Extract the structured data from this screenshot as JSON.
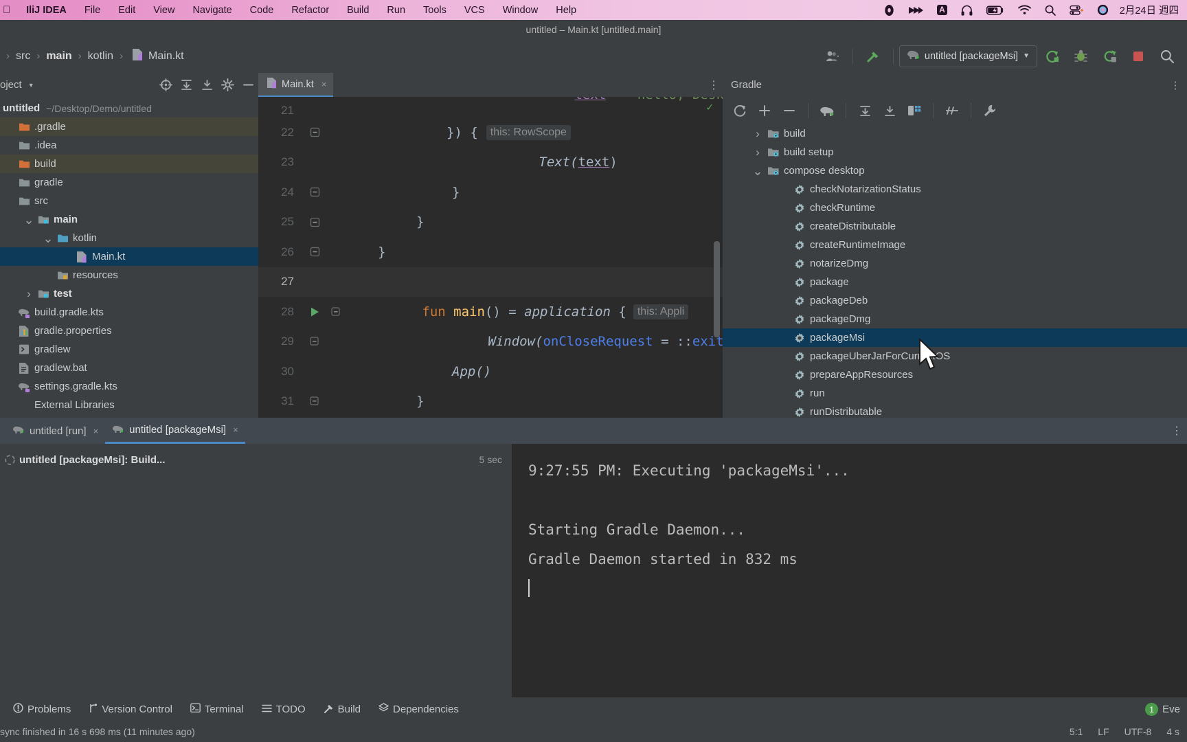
{
  "macbar": {
    "apple_glyph": "●",
    "menus": [
      {
        "label": "IliJ IDEA",
        "bold": true
      },
      {
        "label": "File",
        "bold": false
      },
      {
        "label": "Edit",
        "bold": false
      },
      {
        "label": "View",
        "bold": false
      },
      {
        "label": "Navigate",
        "bold": false
      },
      {
        "label": "Code",
        "bold": false
      },
      {
        "label": "Refactor",
        "bold": false
      },
      {
        "label": "Build",
        "bold": false
      },
      {
        "label": "Run",
        "bold": false
      },
      {
        "label": "Tools",
        "bold": false
      },
      {
        "label": "VCS",
        "bold": false
      },
      {
        "label": "Window",
        "bold": false
      },
      {
        "label": "Help",
        "bold": false
      }
    ],
    "status_icons": [
      "record-icon",
      "fastforward-icon",
      "input-source-A-icon",
      "headphones-icon",
      "battery-charging-icon",
      "wifi-icon",
      "search-icon",
      "control-center-icon",
      "siri-icon"
    ],
    "date": "2月24日 週四"
  },
  "titlebar": {
    "title": "untitled – Main.kt [untitled.main]"
  },
  "navbar": {
    "breadcrumbs": [
      "src",
      "main",
      "kotlin",
      "Main.kt"
    ],
    "separator": "›",
    "run_config": "untitled [packageMsi]",
    "buttons": [
      "account-icon",
      "hammer-build-icon",
      "rerun-icon",
      "debug-icon",
      "coverage-icon",
      "stop-icon",
      "search-everywhere-icon"
    ]
  },
  "project": {
    "title": "oject",
    "toolbar_icons": [
      "locate-icon",
      "expand-all-icon",
      "collapse-all-icon",
      "settings-gear-icon",
      "hide-icon"
    ],
    "root": {
      "name": "untitled",
      "path": "~/Desktop/Demo/untitled"
    },
    "items": [
      {
        "label": ".gradle",
        "icon": "folder-excluded-icon",
        "indent": 0,
        "arrow": "",
        "highlight": true,
        "selected": false,
        "bold": false
      },
      {
        "label": ".idea",
        "icon": "folder-icon",
        "indent": 0,
        "arrow": "",
        "highlight": false,
        "selected": false,
        "bold": false
      },
      {
        "label": "build",
        "icon": "folder-excluded-icon",
        "indent": 0,
        "arrow": "",
        "highlight": true,
        "selected": false,
        "bold": false
      },
      {
        "label": "gradle",
        "icon": "folder-icon",
        "indent": 0,
        "arrow": "",
        "highlight": false,
        "selected": false,
        "bold": false
      },
      {
        "label": "src",
        "icon": "folder-icon",
        "indent": 0,
        "arrow": "",
        "highlight": false,
        "selected": false,
        "bold": false
      },
      {
        "label": "main",
        "icon": "folder-source-icon",
        "indent": 1,
        "arrow": "v",
        "highlight": false,
        "selected": false,
        "bold": true
      },
      {
        "label": "kotlin",
        "icon": "folder-blue-icon",
        "indent": 2,
        "arrow": "v",
        "highlight": false,
        "selected": false,
        "bold": false
      },
      {
        "label": "Main.kt",
        "icon": "kotlin-file-icon",
        "indent": 3,
        "arrow": "",
        "highlight": false,
        "selected": true,
        "bold": false
      },
      {
        "label": "resources",
        "icon": "folder-resources-icon",
        "indent": 2,
        "arrow": "",
        "highlight": false,
        "selected": false,
        "bold": false
      },
      {
        "label": "test",
        "icon": "folder-test-icon",
        "indent": 1,
        "arrow": ">",
        "highlight": false,
        "selected": false,
        "bold": true
      },
      {
        "label": "build.gradle.kts",
        "icon": "gradle-kts-icon",
        "indent": 0,
        "arrow": "",
        "highlight": false,
        "selected": false,
        "bold": false
      },
      {
        "label": "gradle.properties",
        "icon": "properties-icon",
        "indent": 0,
        "arrow": "",
        "highlight": false,
        "selected": false,
        "bold": false
      },
      {
        "label": "gradlew",
        "icon": "script-icon",
        "indent": 0,
        "arrow": "",
        "highlight": false,
        "selected": false,
        "bold": false
      },
      {
        "label": "gradlew.bat",
        "icon": "bat-file-icon",
        "indent": 0,
        "arrow": "",
        "highlight": false,
        "selected": false,
        "bold": false
      },
      {
        "label": "settings.gradle.kts",
        "icon": "gradle-kts-icon",
        "indent": 0,
        "arrow": "",
        "highlight": false,
        "selected": false,
        "bold": false
      },
      {
        "label": "External Libraries",
        "icon": "none",
        "indent": 0,
        "arrow": "",
        "highlight": false,
        "selected": false,
        "bold": false
      }
    ]
  },
  "editor": {
    "tab": {
      "label": "Main.kt",
      "close": "×",
      "icon": "kotlin-file-icon"
    },
    "lines": [
      {
        "num": "21",
        "fold": "",
        "run": false
      },
      {
        "num": "22",
        "fold": "-",
        "run": false
      },
      {
        "num": "23",
        "fold": "",
        "run": false
      },
      {
        "num": "24",
        "fold": "-",
        "run": false
      },
      {
        "num": "25",
        "fold": "-",
        "run": false
      },
      {
        "num": "26",
        "fold": "-",
        "run": false
      },
      {
        "num": "27",
        "fold": "",
        "run": false
      },
      {
        "num": "28",
        "fold": "-",
        "run": true
      },
      {
        "num": "29",
        "fold": "-",
        "run": false
      },
      {
        "num": "30",
        "fold": "",
        "run": false
      },
      {
        "num": "31",
        "fold": "-",
        "run": false
      }
    ],
    "code": {
      "l21_a": "text",
      "l21_b": " = ",
      "l21_c": "\"hello, Desktop!\"",
      "l22_a": "}) {",
      "l22_hint": "this: RowScope",
      "l23_a": "Text(",
      "l23_b": "text",
      "l23_c": ")",
      "l24": "}",
      "l25": "}",
      "l26": "}",
      "l28_kw": "fun ",
      "l28_fn": "main",
      "l28_mid": "() = ",
      "l28_ital": "application",
      "l28_brace": " {",
      "l28_hint": "this: Appli",
      "l29_ital": "Window(",
      "l29_prm": "onCloseRequest",
      "l29_eq": " = ::",
      "l29_tail": "exitAp",
      "l30": "App()",
      "l31": "}"
    }
  },
  "gradle": {
    "title": "Gradle",
    "toolbar_icons": [
      "refresh-icon",
      "add-icon",
      "remove-icon",
      "execute-gradle-task-icon",
      "expand-all-icon",
      "collapse-all-icon",
      "modules-icon",
      "toggle-offline-icon",
      "wrench-settings-icon"
    ],
    "items": [
      {
        "label": "build",
        "type": "group",
        "arrow": ">",
        "selected": false
      },
      {
        "label": "build setup",
        "type": "group",
        "arrow": ">",
        "selected": false
      },
      {
        "label": "compose desktop",
        "type": "group",
        "arrow": "v",
        "selected": false
      },
      {
        "label": "checkNotarizationStatus",
        "type": "task",
        "arrow": "",
        "selected": false
      },
      {
        "label": "checkRuntime",
        "type": "task",
        "arrow": "",
        "selected": false
      },
      {
        "label": "createDistributable",
        "type": "task",
        "arrow": "",
        "selected": false
      },
      {
        "label": "createRuntimeImage",
        "type": "task",
        "arrow": "",
        "selected": false
      },
      {
        "label": "notarizeDmg",
        "type": "task",
        "arrow": "",
        "selected": false
      },
      {
        "label": "package",
        "type": "task",
        "arrow": "",
        "selected": false
      },
      {
        "label": "packageDeb",
        "type": "task",
        "arrow": "",
        "selected": false
      },
      {
        "label": "packageDmg",
        "type": "task",
        "arrow": "",
        "selected": false
      },
      {
        "label": "packageMsi",
        "type": "task",
        "arrow": "",
        "selected": true
      },
      {
        "label": "packageUberJarForCurrentOS",
        "type": "task",
        "arrow": "",
        "selected": false
      },
      {
        "label": "prepareAppResources",
        "type": "task",
        "arrow": "",
        "selected": false
      },
      {
        "label": "run",
        "type": "task",
        "arrow": "",
        "selected": false
      },
      {
        "label": "runDistributable",
        "type": "task",
        "arrow": "",
        "selected": false
      }
    ]
  },
  "build_panel": {
    "tabs": [
      {
        "label": "untitled [run]",
        "active": false,
        "icon": "gradle-icon",
        "close": "×"
      },
      {
        "label": "untitled [packageMsi]",
        "active": true,
        "icon": "gradle-icon",
        "close": "×"
      }
    ],
    "tree_row": {
      "label": "untitled [packageMsi]: Build...",
      "icon": "spinner-icon",
      "time": "5 sec"
    },
    "console": [
      "9:27:55 PM: Executing 'packageMsi'...",
      "",
      "Starting Gradle Daemon...",
      "Gradle Daemon started in 832 ms"
    ]
  },
  "toolwindow_bar": {
    "buttons": [
      {
        "label": "Problems",
        "icon": "problems-icon"
      },
      {
        "label": "Version Control",
        "icon": "branch-icon"
      },
      {
        "label": "Terminal",
        "icon": "terminal-icon"
      },
      {
        "label": "TODO",
        "icon": "todo-icon"
      },
      {
        "label": "Build",
        "icon": "build-hammer-icon"
      },
      {
        "label": "Dependencies",
        "icon": "dependencies-icon"
      }
    ],
    "event_log": {
      "count": "1",
      "label": "Eve"
    }
  },
  "statusbar": {
    "message": "sync finished in 16 s 698 ms (11 minutes ago)",
    "caret_pos": "5:1",
    "line_sep": "LF",
    "encoding": "UTF-8",
    "indent": "4 s"
  },
  "colors": {
    "accent_blue": "#4a88c7",
    "selection": "#0d3a58",
    "editor_bg": "#2b2b2b",
    "panel_bg": "#3c3f41",
    "menu_pink": "#eebde0"
  }
}
